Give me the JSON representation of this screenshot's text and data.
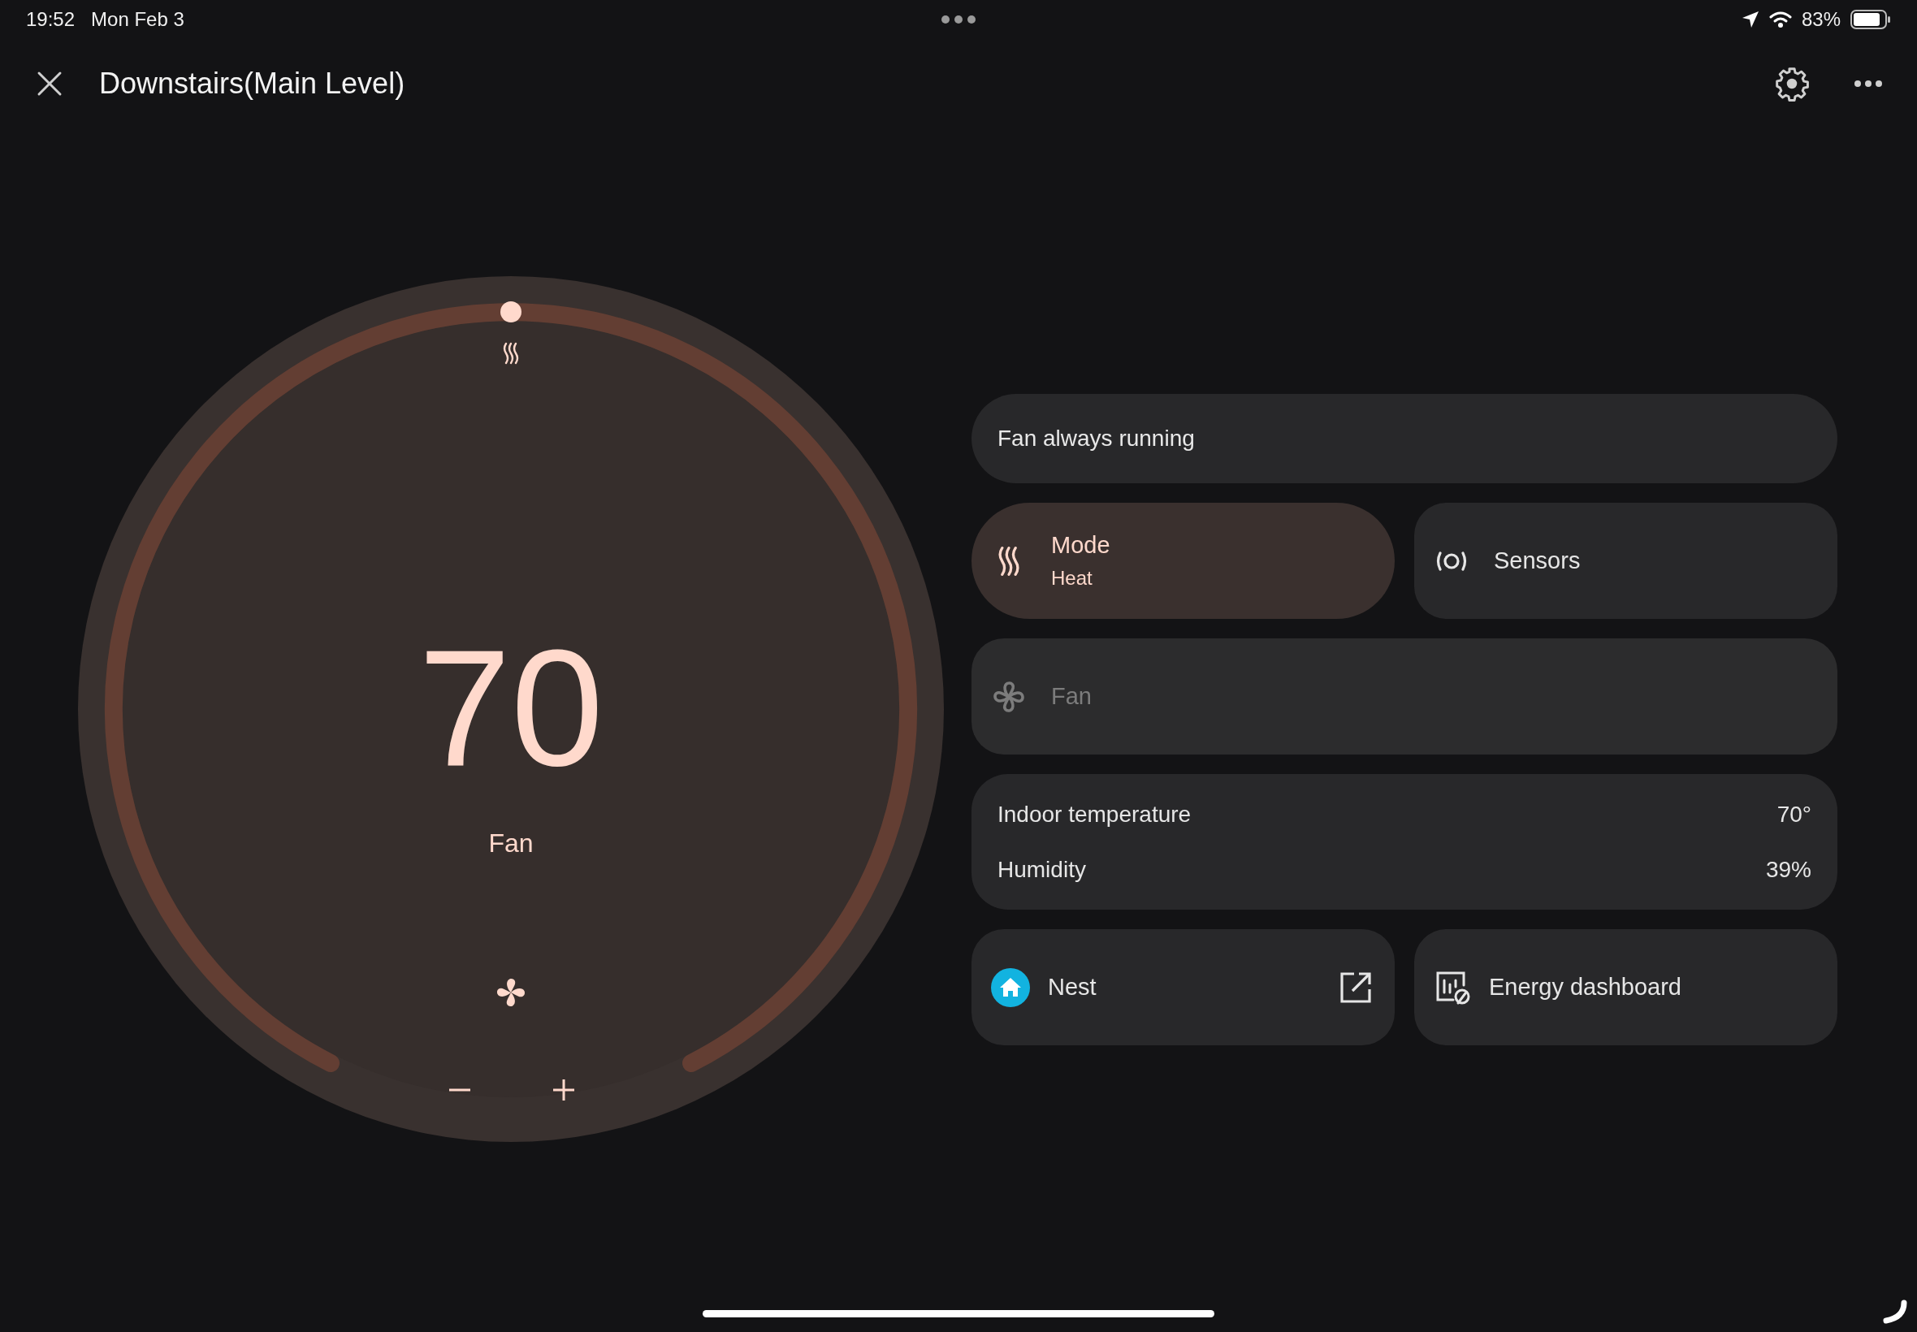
{
  "status_bar": {
    "time": "19:52",
    "date": "Mon Feb 3",
    "battery": "83%"
  },
  "header": {
    "title": "Downstairs(Main Level)"
  },
  "dial": {
    "temperature": "70",
    "label": "Fan"
  },
  "fan_banner": "Fan always running",
  "tiles": [
    {
      "kind": "mode",
      "title": "Mode",
      "subtitle": "Heat",
      "active": true,
      "disabled": false
    },
    {
      "kind": "sensors",
      "title": "Sensors",
      "active": false,
      "disabled": false
    },
    {
      "kind": "fan",
      "title": "Fan",
      "active": false,
      "disabled": true
    }
  ],
  "readings": [
    {
      "label": "Indoor temperature",
      "value": "70°"
    },
    {
      "label": "Humidity",
      "value": "39%"
    }
  ],
  "links": [
    {
      "kind": "nest",
      "label": "Nest"
    },
    {
      "kind": "energy",
      "label": "Energy dashboard"
    }
  ]
}
